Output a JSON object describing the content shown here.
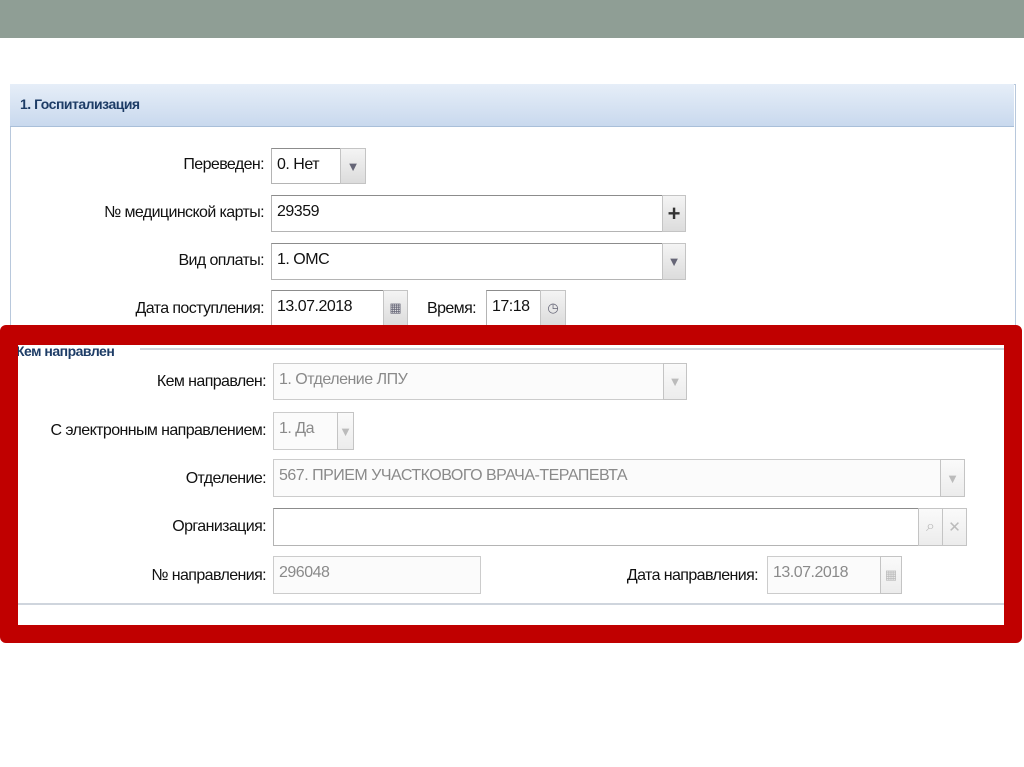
{
  "section_title": "1. Госпитализация",
  "hosp": {
    "transferred": {
      "label": "Переведен:",
      "value": "0. Нет"
    },
    "card": {
      "label": "№ медицинской карты:",
      "value": "29359",
      "add": "+"
    },
    "payment": {
      "label": "Вид оплаты:",
      "value": "1. ОМС"
    },
    "date": {
      "label": "Дата поступления:",
      "value": "13.07.2018"
    },
    "time": {
      "label": "Время:",
      "value": "17:18"
    }
  },
  "referral": {
    "legend": "Кем направлен",
    "by": {
      "label": "Кем направлен:",
      "value": "1. Отделение ЛПУ"
    },
    "electronic": {
      "label": "С электронным направлением:",
      "value": "1. Да"
    },
    "department": {
      "label": "Отделение:",
      "value": "567. ПРИЕМ УЧАСТКОВОГО ВРАЧА-ТЕРАПЕВТА"
    },
    "organization": {
      "label": "Организация:",
      "value": ""
    },
    "number": {
      "label": "№ направления:",
      "value": "296048"
    },
    "date": {
      "label": "Дата направления:",
      "value": "13.07.2018"
    }
  },
  "colors": {
    "highlight": "#c00000",
    "header": "#1d3c66"
  }
}
